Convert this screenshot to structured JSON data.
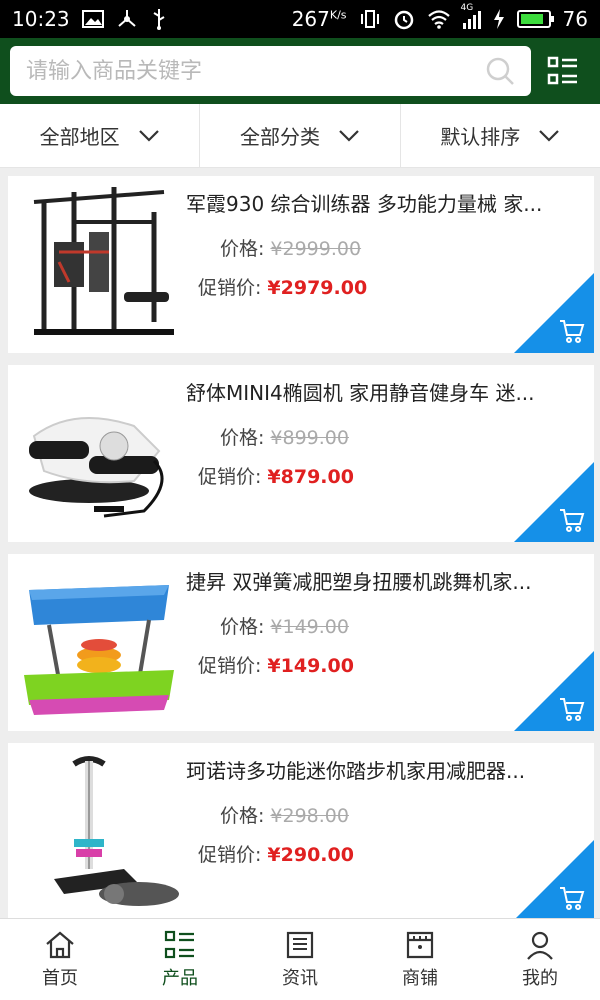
{
  "status": {
    "time": "10:23",
    "net_speed": "267",
    "net_unit": "K/s",
    "network": "4G",
    "battery": "76"
  },
  "search": {
    "placeholder": "请输入商品关键字"
  },
  "filters": [
    {
      "label": "全部地区"
    },
    {
      "label": "全部分类"
    },
    {
      "label": "默认排序"
    }
  ],
  "products": [
    {
      "title": "军霞930 综合训练器 多功能力量械 家...",
      "price_label": "价格:",
      "price": "¥2999.00",
      "promo_label": "促销价:",
      "promo_price": "¥2979.00"
    },
    {
      "title": "舒体MINI4椭圆机 家用静音健身车 迷...",
      "price_label": "价格:",
      "price": "¥899.00",
      "promo_label": "促销价:",
      "promo_price": "¥879.00"
    },
    {
      "title": "捷昇 双弹簧减肥塑身扭腰机跳舞机家...",
      "price_label": "价格:",
      "price": "¥149.00",
      "promo_label": "促销价:",
      "promo_price": "¥149.00"
    },
    {
      "title": "珂诺诗多功能迷你踏步机家用减肥器...",
      "price_label": "价格:",
      "price": "¥298.00",
      "promo_label": "促销价:",
      "promo_price": "¥290.00"
    }
  ],
  "nav": [
    {
      "label": "首页",
      "icon": "home-icon"
    },
    {
      "label": "产品",
      "icon": "list-icon",
      "active": true
    },
    {
      "label": "资讯",
      "icon": "news-icon"
    },
    {
      "label": "商铺",
      "icon": "shop-icon"
    },
    {
      "label": "我的",
      "icon": "user-icon"
    }
  ],
  "colors": {
    "header": "#0f4f1d",
    "accent_blue": "#1590e8",
    "promo_red": "#e02020"
  }
}
